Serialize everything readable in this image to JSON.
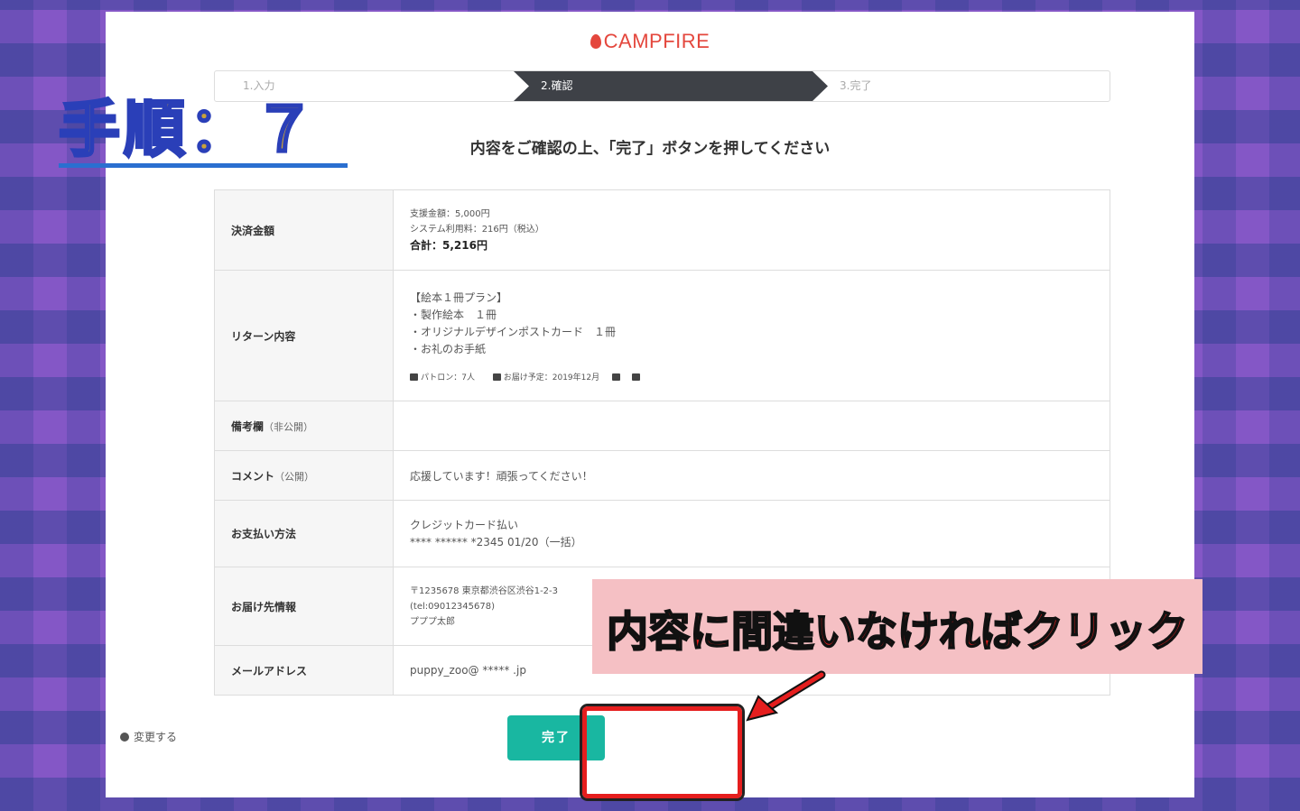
{
  "header": {
    "logo_text": "CAMPFIRE"
  },
  "steps": [
    {
      "label": "1.入力"
    },
    {
      "label": "2.確認"
    },
    {
      "label": "3.完了"
    }
  ],
  "headline": "内容をご確認の上、「完了」ボタンを押してください",
  "overlay": {
    "step_label": "手順：７",
    "callout": "内容に間違いなければクリック"
  },
  "table": {
    "payment": {
      "label": "決済金額",
      "support": "支援金額：5,000円",
      "fee": "システム利用料：216円（税込）",
      "total": "合計：5,216円"
    },
    "return": {
      "label": "リターン内容",
      "lines": [
        "【絵本１冊プラン】",
        "・製作絵本　１冊",
        "・オリジナルデザインポストカード　１冊",
        "・お礼のお手紙"
      ],
      "patrons": "パトロン：7人",
      "delivery": "お届け予定：2019年12月"
    },
    "note": {
      "label": "備考欄",
      "sub": "（非公開）",
      "value": ""
    },
    "comment": {
      "label": "コメント",
      "sub": "（公開）",
      "value": "応援しています！頑張ってください！"
    },
    "pay_method": {
      "label": "お支払い方法",
      "line1": "クレジットカード払い",
      "line2": "**** ****** *2345  01/20（一括）"
    },
    "delivery_info": {
      "label": "お届け先情報",
      "postal": "〒1235678 東京都渋谷区渋谷1-2-3",
      "tel": "(tel:09012345678)",
      "name": "プププ太郎"
    },
    "email": {
      "label": "メールアドレス",
      "value": "puppy_zoo@ ***** .jp"
    }
  },
  "actions": {
    "back_label": "変更する",
    "complete_label": "完了"
  }
}
